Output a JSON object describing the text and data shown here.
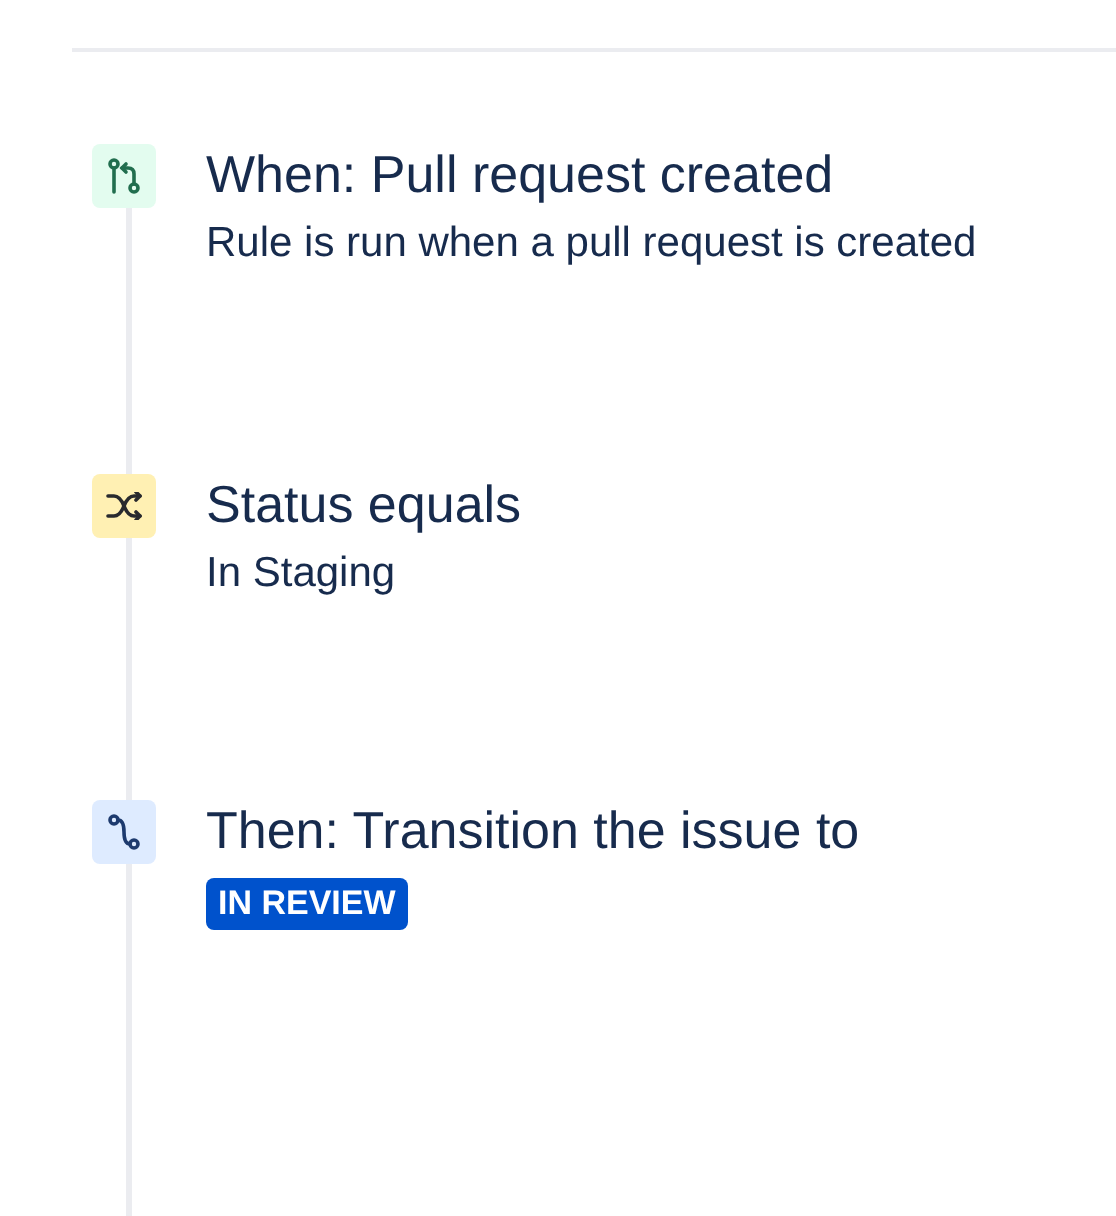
{
  "steps": [
    {
      "kind": "trigger",
      "title": "When: Pull request created",
      "description": "Rule is run when a pull request is created"
    },
    {
      "kind": "condition",
      "title": "Status equals",
      "description": "In Staging"
    },
    {
      "kind": "action",
      "title": "Then: Transition the issue to",
      "status_lozenge": "IN REVIEW"
    }
  ]
}
